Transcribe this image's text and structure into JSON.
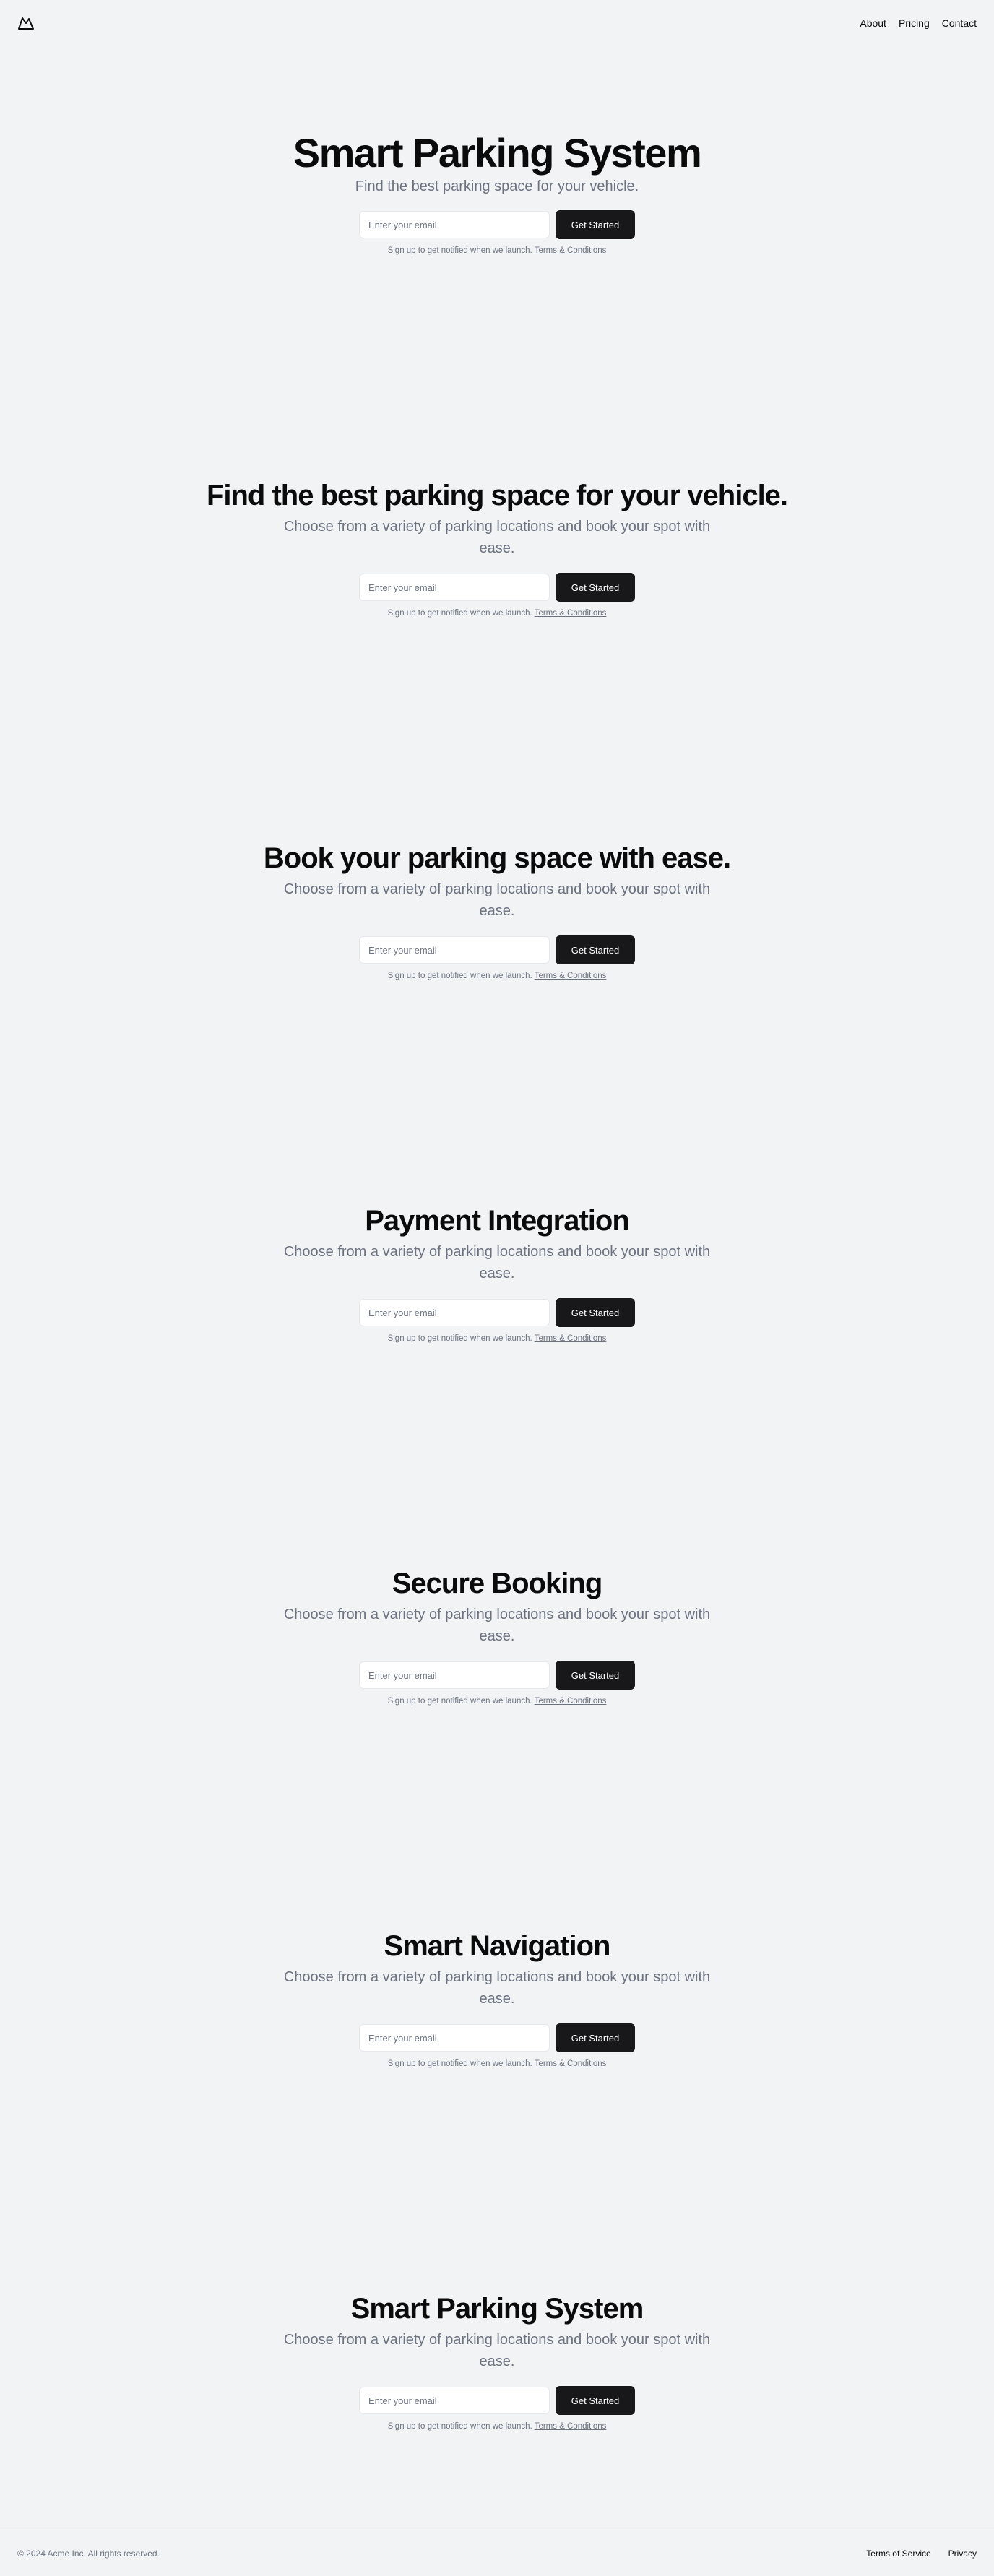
{
  "header": {
    "logo_icon": "mountain-icon",
    "nav": [
      "About",
      "Pricing",
      "Contact"
    ]
  },
  "sections": [
    {
      "title": "Smart Parking System",
      "subtitle": "Find the best parking space for your vehicle.",
      "email_placeholder": "Enter your email",
      "cta_label": "Get Started",
      "note_text": "Sign up to get notified when we launch. ",
      "note_link": "Terms & Conditions"
    },
    {
      "title": "Find the best parking space for your vehicle.",
      "subtitle": "Choose from a variety of parking locations and book your spot with ease.",
      "email_placeholder": "Enter your email",
      "cta_label": "Get Started",
      "note_text": "Sign up to get notified when we launch. ",
      "note_link": "Terms & Conditions"
    },
    {
      "title": "Book your parking space with ease.",
      "subtitle": "Choose from a variety of parking locations and book your spot with ease.",
      "email_placeholder": "Enter your email",
      "cta_label": "Get Started",
      "note_text": "Sign up to get notified when we launch. ",
      "note_link": "Terms & Conditions"
    },
    {
      "title": "Payment Integration",
      "subtitle": "Choose from a variety of parking locations and book your spot with ease.",
      "email_placeholder": "Enter your email",
      "cta_label": "Get Started",
      "note_text": "Sign up to get notified when we launch. ",
      "note_link": "Terms & Conditions"
    },
    {
      "title": "Secure Booking",
      "subtitle": "Choose from a variety of parking locations and book your spot with ease.",
      "email_placeholder": "Enter your email",
      "cta_label": "Get Started",
      "note_text": "Sign up to get notified when we launch. ",
      "note_link": "Terms & Conditions"
    },
    {
      "title": "Smart Navigation",
      "subtitle": "Choose from a variety of parking locations and book your spot with ease.",
      "email_placeholder": "Enter your email",
      "cta_label": "Get Started",
      "note_text": "Sign up to get notified when we launch. ",
      "note_link": "Terms & Conditions"
    },
    {
      "title": "Smart Parking System",
      "subtitle": "Choose from a variety of parking locations and book your spot with ease.",
      "email_placeholder": "Enter your email",
      "cta_label": "Get Started",
      "note_text": "Sign up to get notified when we launch. ",
      "note_link": "Terms & Conditions"
    }
  ],
  "footer": {
    "copyright": "© 2024 Acme Inc. All rights reserved.",
    "links": [
      "Terms of Service",
      "Privacy"
    ]
  },
  "colors": {
    "background": "#f2f3f5",
    "button": "#18181b",
    "muted_text": "#6b7280"
  }
}
